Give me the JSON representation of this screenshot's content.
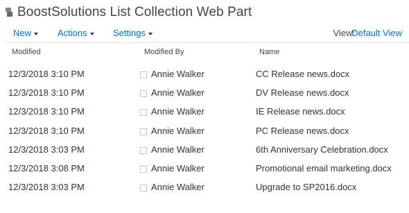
{
  "webpart": {
    "title": "BoostSolutions List Collection Web Part",
    "icon": "document-library-icon"
  },
  "toolbar": {
    "new_label": "New",
    "actions_label": "Actions",
    "settings_label": "Settings",
    "view_label": "View:",
    "view_value": "Default View"
  },
  "columns": {
    "modified": "Modified",
    "modified_by": "Modified By",
    "name": "Name"
  },
  "rows": [
    {
      "modified": "12/3/2018 3:10 PM",
      "modified_by": "Annie Walker",
      "name": "CC Release news.docx"
    },
    {
      "modified": "12/3/2018 3:10 PM",
      "modified_by": "Annie Walker",
      "name": "DV Release news.docx"
    },
    {
      "modified": "12/3/2018 3:10 PM",
      "modified_by": "Annie Walker",
      "name": "IE Release news.docx"
    },
    {
      "modified": "12/3/2018 3:10 PM",
      "modified_by": "Annie Walker",
      "name": "PC Release news.docx"
    },
    {
      "modified": "12/3/2018 3:03 PM",
      "modified_by": "Annie Walker",
      "name": "6th Anniversary Celebration.docx"
    },
    {
      "modified": "12/3/2018 3:08 PM",
      "modified_by": "Annie Walker",
      "name": "Promotional email marketing.docx"
    },
    {
      "modified": "12/3/2018 3:03 PM",
      "modified_by": "Annie Walker",
      "name": "Upgrade to SP2016.docx"
    }
  ],
  "colors": {
    "link": "#0072c6",
    "text": "#333333",
    "title": "#444444"
  }
}
